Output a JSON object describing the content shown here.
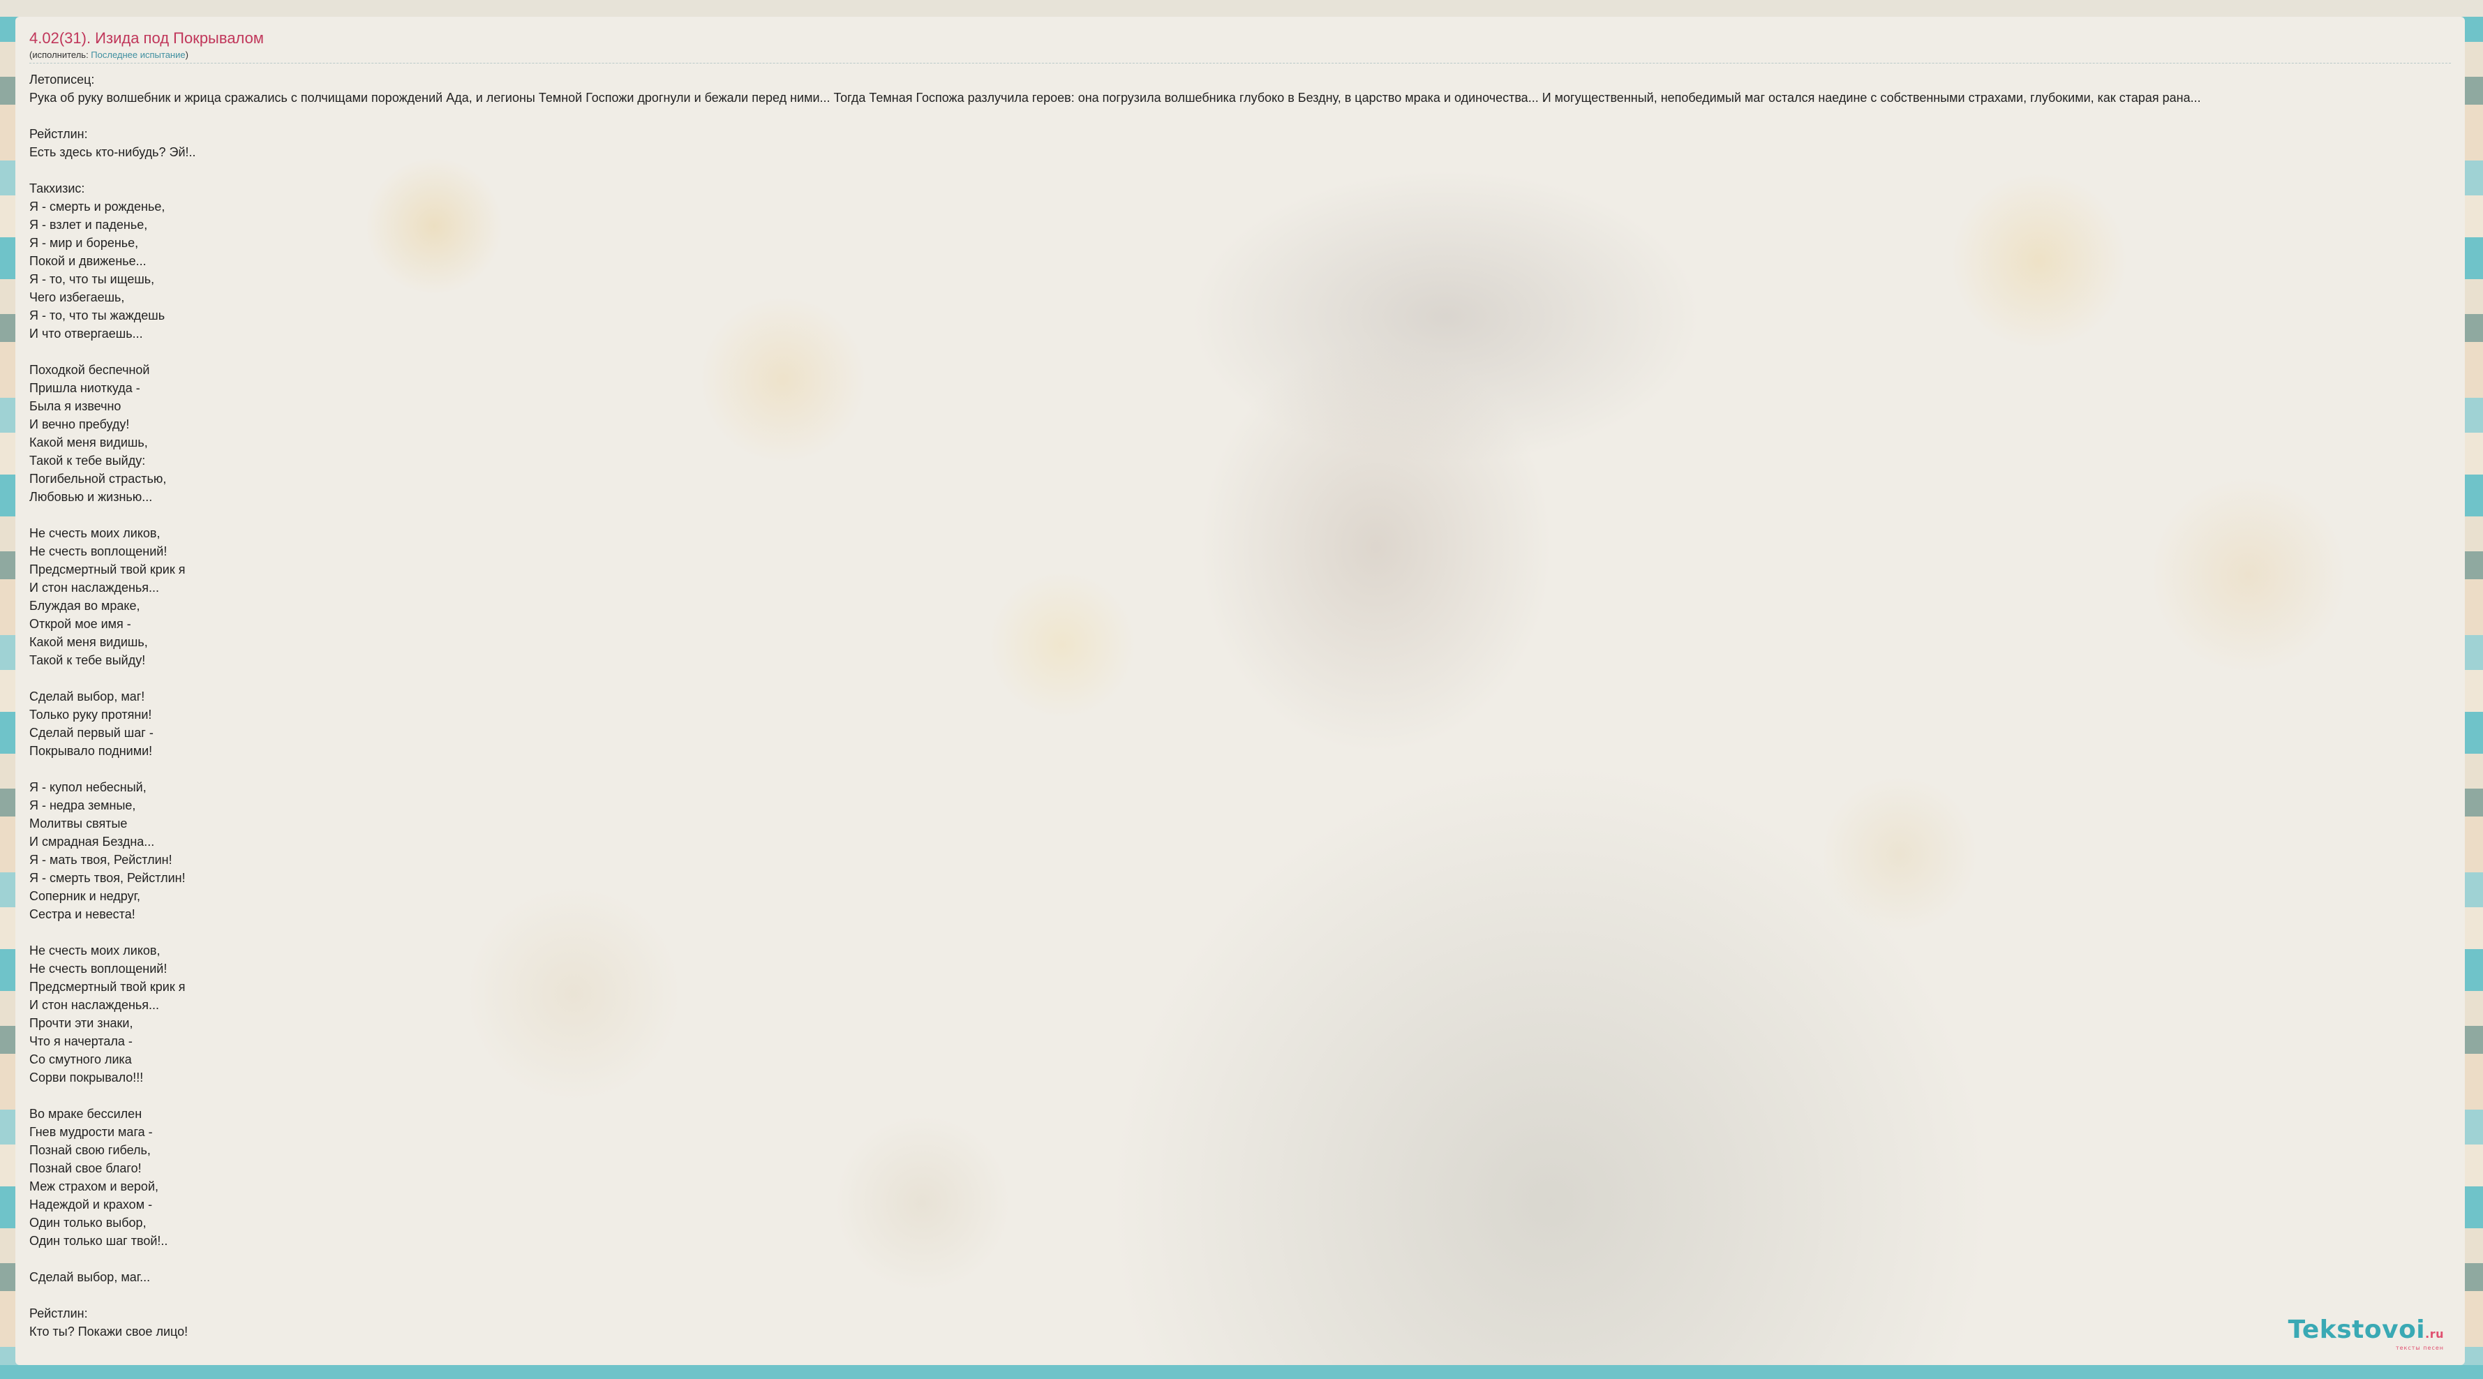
{
  "song": {
    "title": "4.02(31). Изида под Покрывалом",
    "performer_prefix": "(исполнитель: ",
    "performer_name": "Последнее испытание",
    "performer_suffix": ")"
  },
  "lyrics": [
    "Летописец:",
    "Рука об руку волшебник и жрица сражались с полчищами порождений Ада, и легионы Темной Госпожи дрогнули и бежали перед ними... Тогда Темная Госпожа разлучила героев: она погрузила волшебника глубоко в Бездну, в царство мрака и одиночества... И могущественный, непобедимый маг остался наедине с собственными страхами, глубокими, как старая рана...",
    "",
    "Рейстлин:",
    "Есть здесь кто-нибудь? Эй!..",
    "",
    "Такхизис:",
    "Я - смерть и рожденье,",
    "Я - взлет и паденье,",
    "Я - мир и боренье,",
    "Покой и движенье...",
    "Я - то, что ты ищешь,",
    "Чего избегаешь,",
    "Я - то, что ты жаждешь",
    "И что отвергаешь...",
    "",
    "Походкой беспечной",
    "Пришла ниоткуда -",
    "Была я извечно",
    "И вечно пребуду!",
    "Какой меня видишь,",
    "Такой к тебе выйду:",
    "Погибельной страстью,",
    "Любовью и жизнью...",
    "",
    "Не счесть моих ликов,",
    "Не счесть воплощений!",
    "Предсмертный твой крик я",
    "И стон наслажденья...",
    "Блуждая во мраке,",
    "Открой мое имя -",
    "Какой меня видишь,",
    "Такой к тебе выйду!",
    "",
    "Сделай выбор, маг!",
    "Только руку протяни!",
    "Сделай первый шаг -",
    "Покрывало подними!",
    "",
    "Я - купол небесный,",
    "Я - недра земные,",
    "Молитвы святые",
    "И смрадная Бездна...",
    "Я - мать твоя, Рейстлин!",
    "Я - смерть твоя, Рейстлин!",
    "Соперник и недруг,",
    "Сестра и невеста!",
    "",
    "Не счесть моих ликов,",
    "Не счесть воплощений!",
    "Предсмертный твой крик я",
    "И стон наслажденья...",
    "Прочти эти знаки,",
    "Что я начертала -",
    "Со смутного лика",
    "Сорви покрывало!!!",
    "",
    "Во мраке бессилен",
    "Гнев мудрости мага -",
    "Познай свою гибель,",
    "Познай свое благо!",
    "Меж страхом и верой,",
    "Надеждой и крахом -",
    "Один только выбор,",
    "Один только шаг твой!..",
    "",
    "Сделай выбор, маг...",
    "",
    "Рейстлин:",
    "Кто ты? Покажи свое лицо!"
  ],
  "logo": {
    "brand": "Tekstovoi",
    "suffix": ".ru",
    "tagline": "тексты песен"
  },
  "colors": {
    "title": "#c0365a",
    "link": "#3f8fa0",
    "logo": "#3aa9b4"
  }
}
